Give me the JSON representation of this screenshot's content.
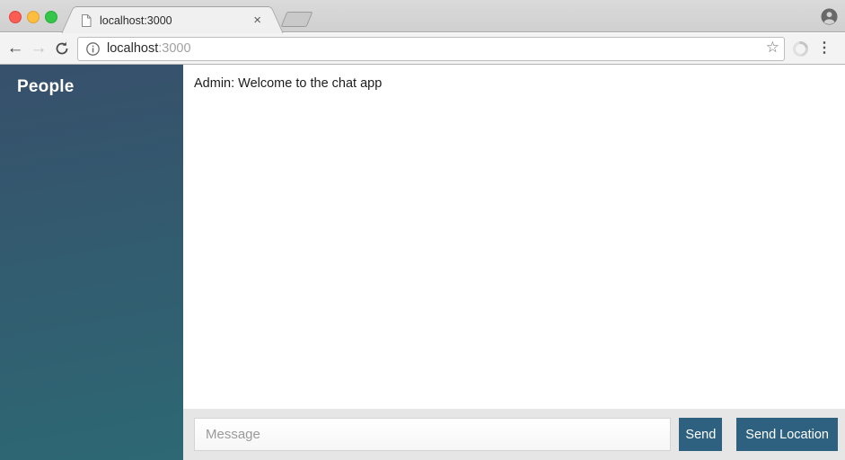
{
  "browser": {
    "tab": {
      "title": "localhost:3000"
    },
    "url": {
      "host": "localhost",
      "port": ":3000"
    },
    "glyphs": {
      "back": "←",
      "forward": "→",
      "close": "×",
      "star": "☆",
      "menu": "⋮"
    }
  },
  "colors": {
    "accent_button": "#2d617f",
    "sidebar_gradient_top": "#37506b",
    "sidebar_gradient_bottom": "#2d6874",
    "composer_background": "#e6e6e6",
    "traffic_red": "#fb5d55",
    "traffic_yellow": "#fdbd3e",
    "traffic_green": "#35c649"
  },
  "sidebar": {
    "title": "People"
  },
  "chat": {
    "messages": [
      {
        "text": "Admin: Welcome to the chat app"
      }
    ]
  },
  "composer": {
    "placeholder": "Message",
    "send_label": "Send",
    "send_location_label": "Send Location"
  }
}
